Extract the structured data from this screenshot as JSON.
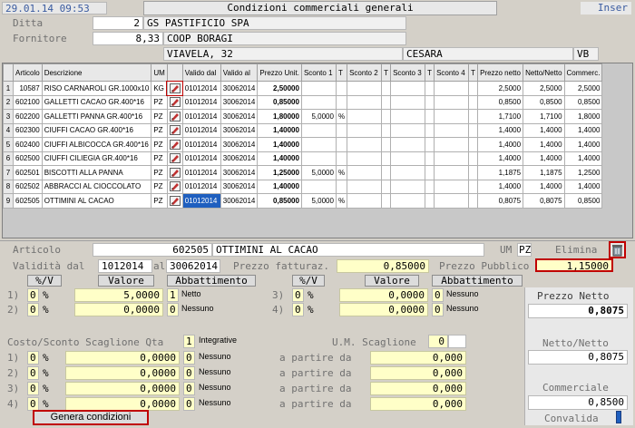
{
  "header": {
    "datetime": "29.01.14 09:53",
    "title": "Condizioni commerciali generali",
    "mode": "Inser"
  },
  "ditta": {
    "label": "Ditta",
    "code": "2",
    "name": "GS PASTIFICIO SPA"
  },
  "fornitore": {
    "label": "Fornitore",
    "code": "8,33",
    "name": "COOP BORAGI",
    "address": "VIAVELA, 32",
    "city": "CESARA",
    "province": "VB"
  },
  "grid": {
    "columns": [
      "",
      "Articolo",
      "Descrizione",
      "UM",
      "",
      "Valido dal",
      "Valido al",
      "Prezzo Unit.",
      "Sconto 1",
      "T",
      "Sconto 2",
      "T",
      "Sconto 3",
      "T",
      "Sconto 4",
      "T",
      "Prezzo netto",
      "Netto/Netto",
      "Commerc."
    ],
    "rows": [
      {
        "n": "1",
        "art": "10587",
        "desc": "RISO CARNAROLI GR.1000x10",
        "um": "KG",
        "dal": "01012014",
        "al": "30062014",
        "prezzo": "2,50000",
        "s1": "",
        "t1": "",
        "s2": "",
        "s3": "",
        "s4": "",
        "netto": "2,5000",
        "nn": "2,5000",
        "comm": "2,5000"
      },
      {
        "n": "2",
        "art": "602100",
        "desc": "GALLETTI CACAO    GR.400*16",
        "um": "PZ",
        "dal": "01012014",
        "al": "30062014",
        "prezzo": "0,85000",
        "s1": "",
        "t1": "",
        "s2": "",
        "s3": "",
        "s4": "",
        "netto": "0,8500",
        "nn": "0,8500",
        "comm": "0,8500"
      },
      {
        "n": "3",
        "art": "602200",
        "desc": "GALLETTI PANNA    GR.400*16",
        "um": "PZ",
        "dal": "01012014",
        "al": "30062014",
        "prezzo": "1,80000",
        "s1": "5,0000",
        "t1": "%",
        "s2": "",
        "s3": "",
        "s4": "",
        "netto": "1,7100",
        "nn": "1,7100",
        "comm": "1,8000"
      },
      {
        "n": "4",
        "art": "602300",
        "desc": "CIUFFI CACAO       GR.400*16",
        "um": "PZ",
        "dal": "01012014",
        "al": "30062014",
        "prezzo": "1,40000",
        "s1": "",
        "t1": "",
        "s2": "",
        "s3": "",
        "s4": "",
        "netto": "1,4000",
        "nn": "1,4000",
        "comm": "1,4000"
      },
      {
        "n": "5",
        "art": "602400",
        "desc": "CIUFFI ALBICOCCA  GR.400*16",
        "um": "PZ",
        "dal": "01012014",
        "al": "30062014",
        "prezzo": "1,40000",
        "s1": "",
        "t1": "",
        "s2": "",
        "s3": "",
        "s4": "",
        "netto": "1,4000",
        "nn": "1,4000",
        "comm": "1,4000"
      },
      {
        "n": "6",
        "art": "602500",
        "desc": "CIUFFI CILIEGIA   GR.400*16",
        "um": "PZ",
        "dal": "01012014",
        "al": "30062014",
        "prezzo": "1,40000",
        "s1": "",
        "t1": "",
        "s2": "",
        "s3": "",
        "s4": "",
        "netto": "1,4000",
        "nn": "1,4000",
        "comm": "1,4000"
      },
      {
        "n": "7",
        "art": "602501",
        "desc": "BISCOTTI ALLA PANNA",
        "um": "PZ",
        "dal": "01012014",
        "al": "30062014",
        "prezzo": "1,25000",
        "s1": "5,0000",
        "t1": "%",
        "s2": "",
        "s3": "",
        "s4": "",
        "netto": "1,1875",
        "nn": "1,1875",
        "comm": "1,2500"
      },
      {
        "n": "8",
        "art": "602502",
        "desc": "ABBRACCI AL CIOCCOLATO",
        "um": "PZ",
        "dal": "01012014",
        "al": "30062014",
        "prezzo": "1,40000",
        "s1": "",
        "t1": "",
        "s2": "",
        "s3": "",
        "s4": "",
        "netto": "1,4000",
        "nn": "1,4000",
        "comm": "1,4000"
      },
      {
        "n": "9",
        "art": "602505",
        "desc": "OTTIMINI AL CACAO",
        "um": "PZ",
        "dal": "01012014",
        "al": "30062014",
        "prezzo": "0,85000",
        "s1": "5,0000",
        "t1": "%",
        "s2": "",
        "s3": "",
        "s4": "",
        "netto": "0,8075",
        "nn": "0,8075",
        "comm": "0,8500"
      }
    ]
  },
  "detail": {
    "articolo_label": "Articolo",
    "articolo_code": "602505",
    "articolo_desc": "OTTIMINI AL CACAO",
    "um_label": "UM",
    "um": "PZ",
    "elimina_label": "Elimina",
    "validita_label": "Validità dal",
    "dal": "1012014",
    "al_label": "al",
    "al": "30062014",
    "prezzo_fatt_label": "Prezzo fatturaz.",
    "prezzo_fatt": "0,85000",
    "prezzo_pub_label": "Prezzo Pubblico",
    "prezzo_pub": "1,15000",
    "sv_label": "%/V",
    "valore_label": "Valore",
    "abbattimento_label": "Abbattimento",
    "left_rows": [
      {
        "n": "1)",
        "t": "0",
        "pct": "%",
        "valore": "5,0000",
        "abb": "1",
        "abb_txt": "Netto"
      },
      {
        "n": "2)",
        "t": "0",
        "pct": "%",
        "valore": "0,0000",
        "abb": "0",
        "abb_txt": "Nessuno"
      }
    ],
    "right_rows": [
      {
        "n": "3)",
        "t": "0",
        "pct": "%",
        "valore": "0,0000",
        "abb": "0",
        "abb_txt": "Nessuno"
      },
      {
        "n": "4)",
        "t": "0",
        "pct": "%",
        "valore": "0,0000",
        "abb": "0",
        "abb_txt": "Nessuno"
      }
    ],
    "prezzo_netto_label": "Prezzo Netto",
    "prezzo_netto": "0,8075",
    "netto_netto_label": "Netto/Netto",
    "netto_netto": "0,8075",
    "commerciale_label": "Commerciale",
    "commerciale": "0,8500",
    "costo_label": "Costo/Sconto Scaglione Qta",
    "integrative_flag": "1",
    "integrative_label": "Integrative",
    "um_scaglione_label": "U.M. Scaglione",
    "um_scaglione": "0",
    "partire_label": "a partire da",
    "scaglioni": [
      {
        "n": "1)",
        "t": "0",
        "pct": "%",
        "valore": "0,0000",
        "abb": "0",
        "abb_txt": "Nessuno",
        "da": "0,000"
      },
      {
        "n": "2)",
        "t": "0",
        "pct": "%",
        "valore": "0,0000",
        "abb": "0",
        "abb_txt": "Nessuno",
        "da": "0,000"
      },
      {
        "n": "3)",
        "t": "0",
        "pct": "%",
        "valore": "0,0000",
        "abb": "0",
        "abb_txt": "Nessuno",
        "da": "0,000"
      },
      {
        "n": "4)",
        "t": "0",
        "pct": "%",
        "valore": "0,0000",
        "abb": "0",
        "abb_txt": "Nessuno",
        "da": "0,000"
      }
    ],
    "genera_label": "Genera condizioni",
    "convalida_label": "Convalida"
  },
  "colors": {
    "accent": "#1f5fbf",
    "field_yellow": "#ffffc8",
    "highlight_red": "#c00000"
  },
  "icons": {
    "row_action": "edit-icon",
    "elimina": "trash-icon"
  }
}
